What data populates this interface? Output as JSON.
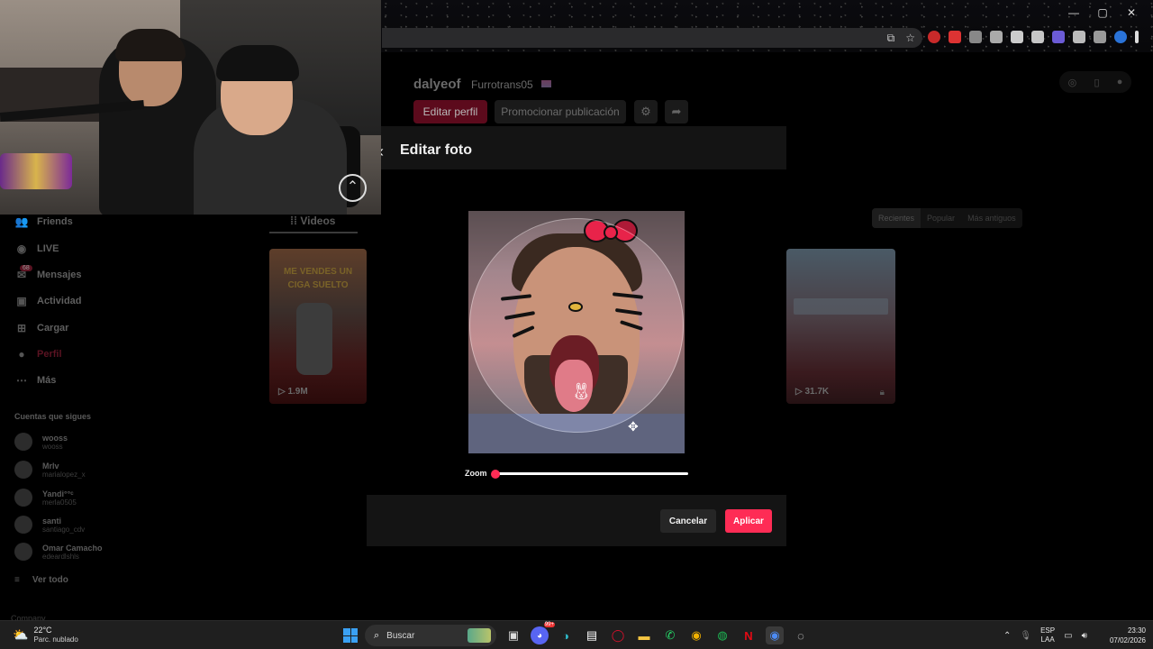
{
  "window_controls": {
    "minimize": "—",
    "maximize": "▢",
    "close": "✕"
  },
  "profile": {
    "username": "dalyeof",
    "handle": "Furrotrans05",
    "edit_profile_label": "Editar perfil",
    "promote_label": "Promocionar publicación"
  },
  "sidebar": {
    "items": [
      {
        "label": "Friends",
        "icon": "friends-icon"
      },
      {
        "label": "LIVE",
        "icon": "live-icon"
      },
      {
        "label": "Mensajes",
        "icon": "messages-icon",
        "badge": "68"
      },
      {
        "label": "Actividad",
        "icon": "activity-icon"
      },
      {
        "label": "Cargar",
        "icon": "upload-icon"
      },
      {
        "label": "Perfil",
        "icon": "profile-icon"
      },
      {
        "label": "Más",
        "icon": "more-icon"
      }
    ],
    "following_title": "Cuentas que sigues",
    "following": [
      {
        "name": "wooss",
        "handle": "wooss"
      },
      {
        "name": "Mrlv",
        "handle": "marialopez_x"
      },
      {
        "name": "Yandi°°ᶜ",
        "handle": "merla0505"
      },
      {
        "name": "santi",
        "handle": "santiago_cdv"
      },
      {
        "name": "Omar Camacho",
        "handle": "edeardlshls"
      }
    ],
    "see_all_label": "Ver todo",
    "company_label": "Company"
  },
  "tabs": {
    "videos_label": "Videos",
    "sort": [
      "Recientes",
      "Popular",
      "Más antiguos"
    ]
  },
  "videos": [
    {
      "caption": "ME VENDES UN CIGA SUELTO",
      "views": "1.9M"
    },
    {
      "views": "31.7K"
    }
  ],
  "modal": {
    "title": "Editar foto",
    "zoom_label": "Zoom",
    "zoom_value": 0.0,
    "cancel_label": "Cancelar",
    "apply_label": "Aplicar"
  },
  "taskbar": {
    "temperature": "22°C",
    "weather": "Parc. nublado",
    "search_placeholder": "Buscar",
    "lang_top": "ESP",
    "lang_bottom": "LAA",
    "time": "23:30",
    "date": "07/02/2026",
    "notification_badge": "99+"
  },
  "colors": {
    "accent": "#fe2c55",
    "modal_bg": "#141414",
    "page_bg": "#000000"
  }
}
